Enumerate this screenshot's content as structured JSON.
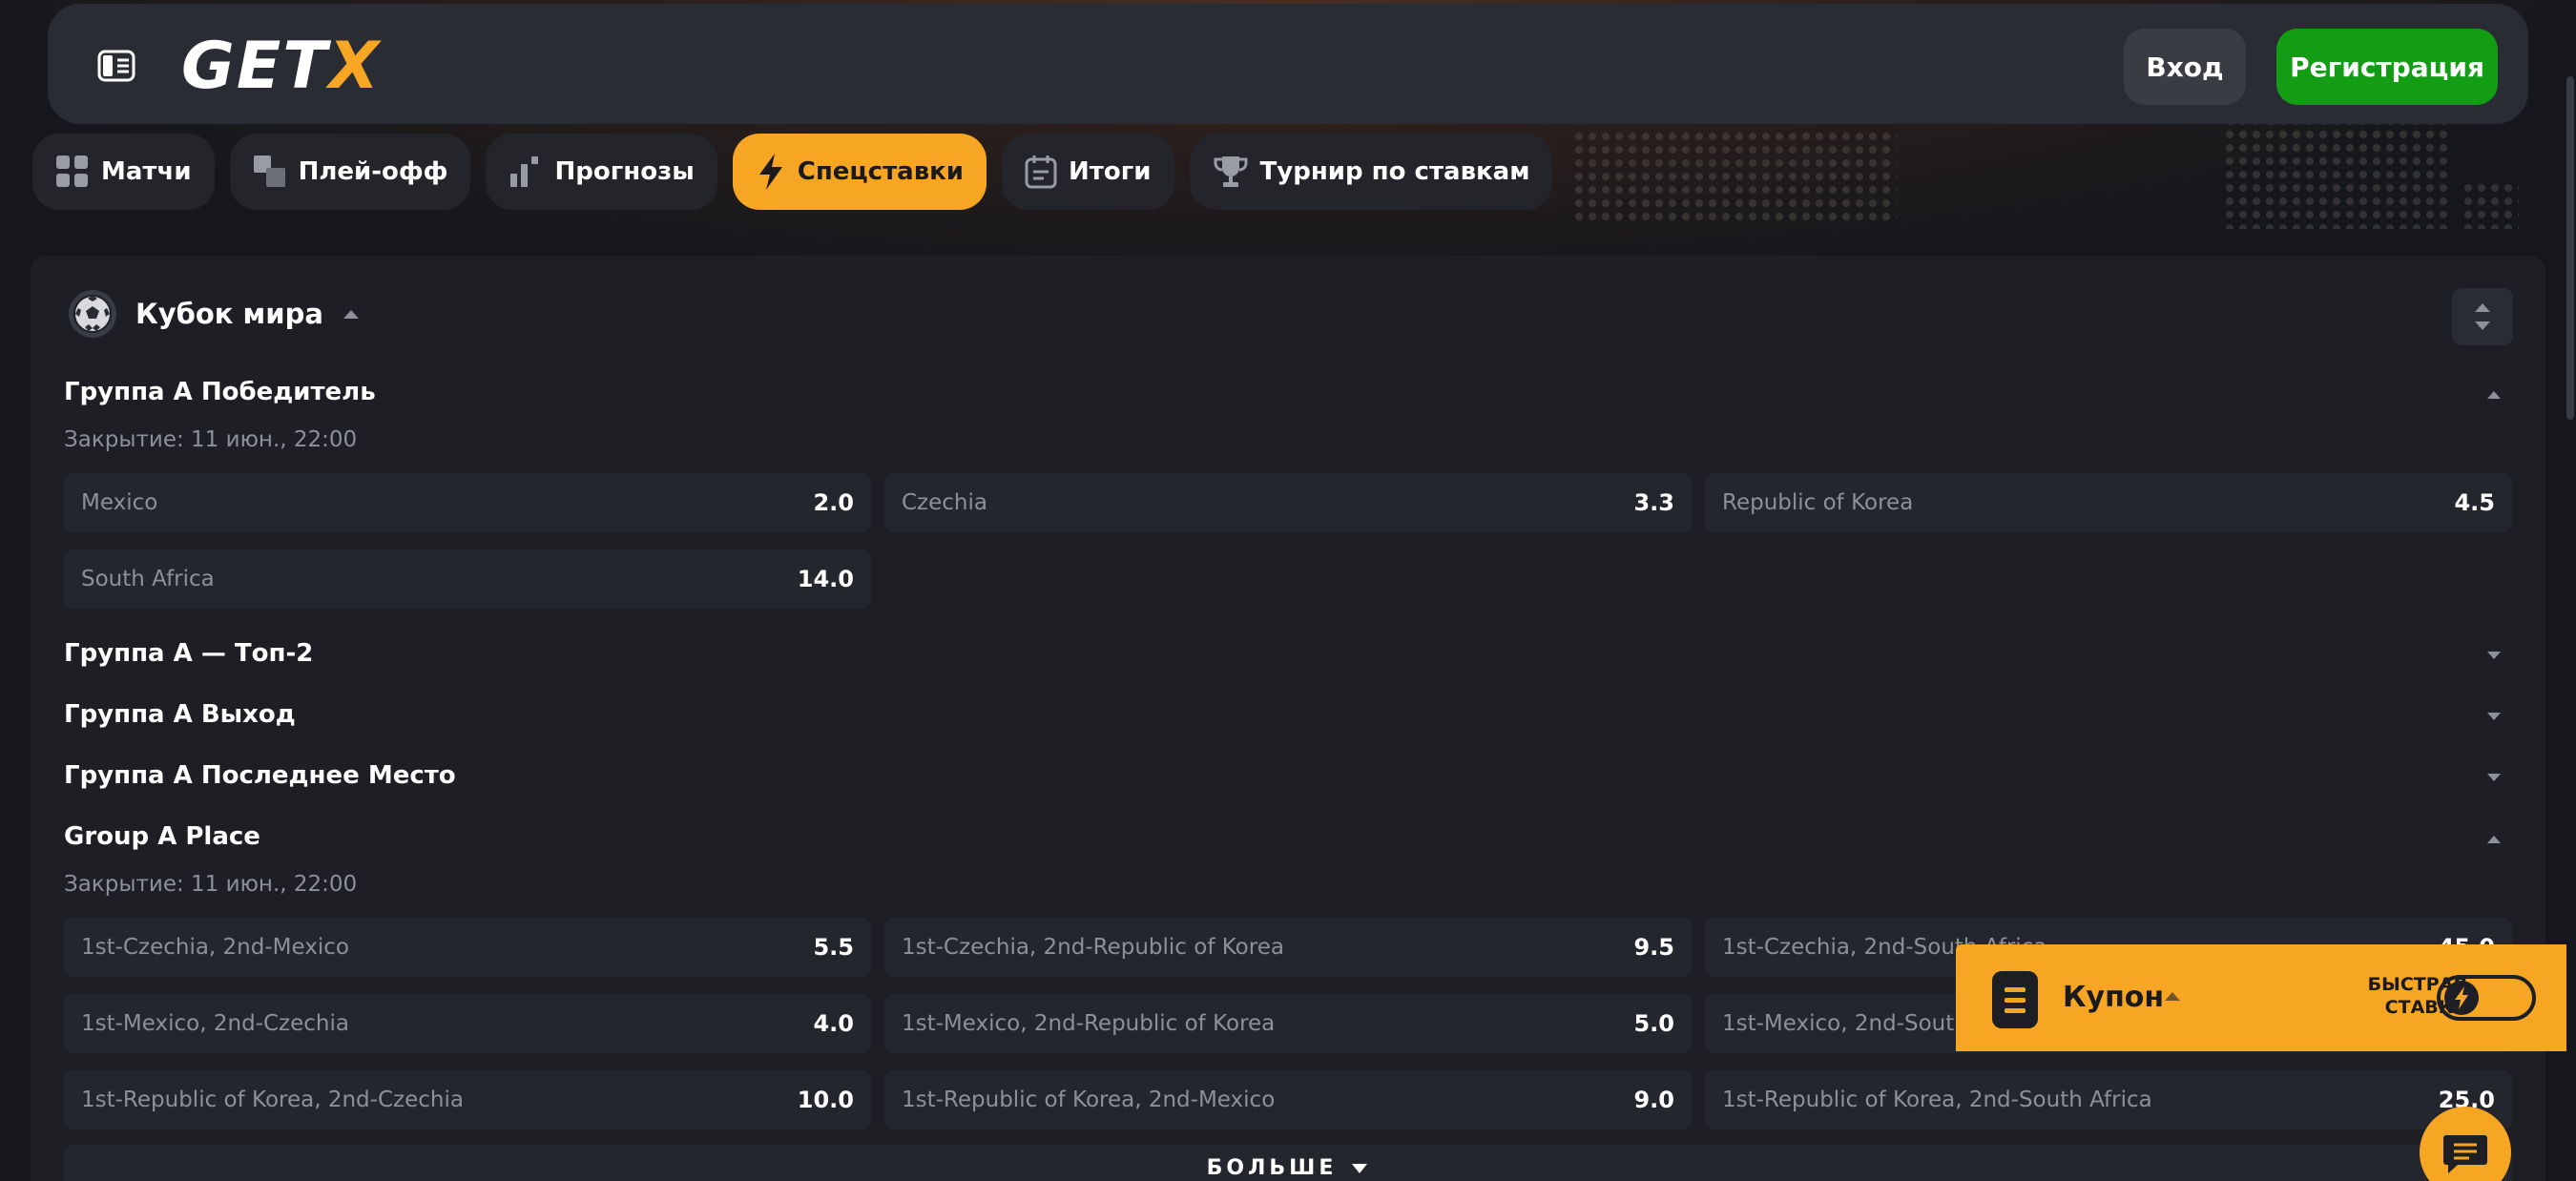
{
  "header": {
    "logo_main": "GET",
    "logo_accent": "X",
    "login_label": "Вход",
    "register_label": "Регистрация"
  },
  "tabs": [
    {
      "label": "Матчи",
      "icon": "grid-icon"
    },
    {
      "label": "Плей-офф",
      "icon": "bracket-icon"
    },
    {
      "label": "Прогнозы",
      "icon": "bars-icon"
    },
    {
      "label": "Спецставки",
      "icon": "lightning-icon",
      "active": true
    },
    {
      "label": "Итоги",
      "icon": "calendar-icon"
    },
    {
      "label": "Турнир по ставкам",
      "icon": "trophy-icon"
    }
  ],
  "competition": {
    "title": "Кубок мира",
    "markets": [
      {
        "title": "Группа А Победитель",
        "expanded": true,
        "closing": "Закрытие: 11 июн., 22:00",
        "odds": [
          {
            "name": "Mexico",
            "value": "2.0"
          },
          {
            "name": "Czechia",
            "value": "3.3"
          },
          {
            "name": "Republic of Korea",
            "value": "4.5"
          },
          {
            "name": "South Africa",
            "value": "14.0"
          }
        ]
      },
      {
        "title": "Группа А — Топ-2",
        "expanded": false
      },
      {
        "title": "Группа А Выход",
        "expanded": false
      },
      {
        "title": "Группа А Последнее Место",
        "expanded": false
      },
      {
        "title": "Group A Place",
        "expanded": true,
        "closing": "Закрытие: 11 июн., 22:00",
        "odds": [
          {
            "name": "1st-Czechia, 2nd-Mexico",
            "value": "5.5"
          },
          {
            "name": "1st-Czechia, 2nd-Republic of Korea",
            "value": "9.5"
          },
          {
            "name": "1st-Czechia, 2nd-South Africa",
            "value": "45.0"
          },
          {
            "name": "1st-Mexico, 2nd-Czechia",
            "value": "4.0"
          },
          {
            "name": "1st-Mexico, 2nd-Republic of Korea",
            "value": "5.0"
          },
          {
            "name": "1st-Mexico, 2nd-South Africa",
            "value": ""
          },
          {
            "name": "1st-Republic of Korea, 2nd-Czechia",
            "value": "10.0"
          },
          {
            "name": "1st-Republic of Korea, 2nd-Mexico",
            "value": "9.0"
          },
          {
            "name": "1st-Republic of Korea, 2nd-South Africa",
            "value": "25.0"
          }
        ]
      }
    ],
    "more_label": "БОЛЬШЕ"
  },
  "coupon": {
    "label": "Купон",
    "quick_bet_line1": "БЫСТРАЯ",
    "quick_bet_line2": "СТАВКА",
    "quick_bet_enabled": false
  },
  "colors": {
    "accent": "#f7a623",
    "register": "#139d15",
    "background": "#15171c",
    "panel": "#1d1f25"
  }
}
